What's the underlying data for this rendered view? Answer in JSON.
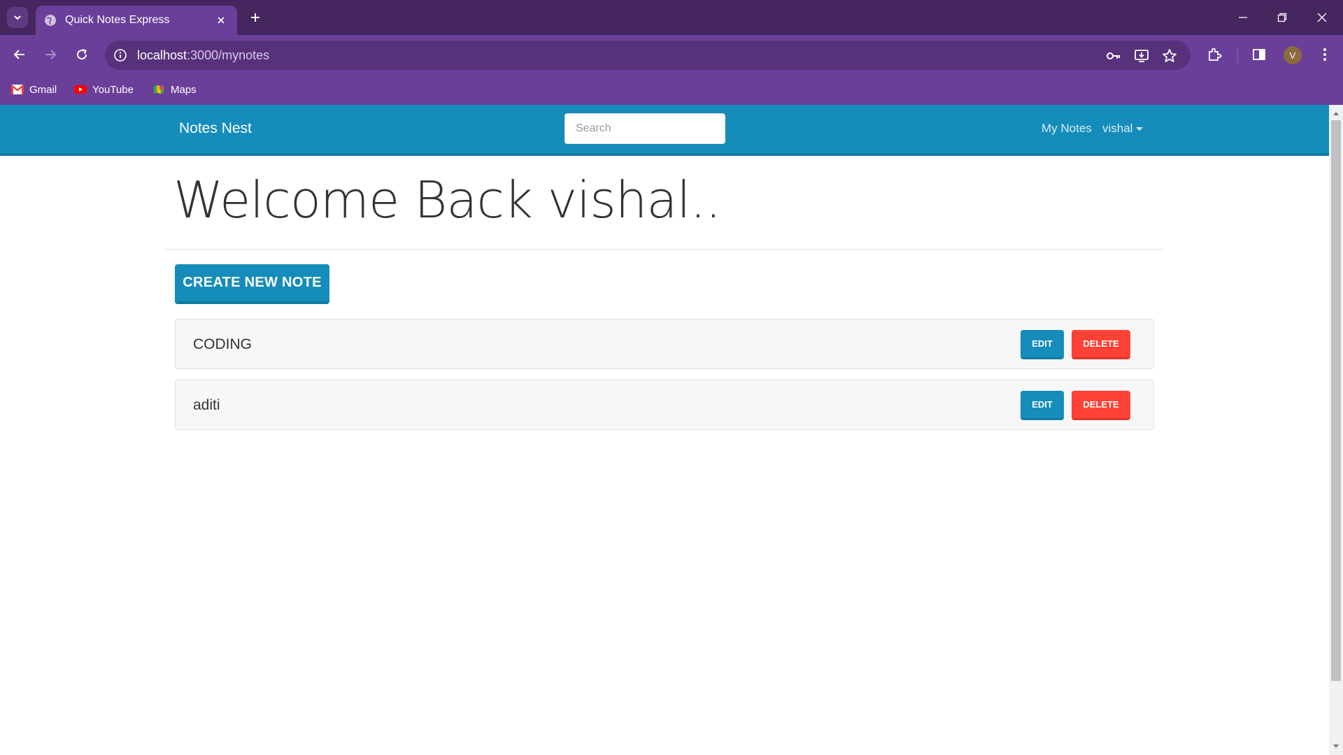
{
  "browser": {
    "tab_title": "Quick Notes Express",
    "url_host": "localhost",
    "url_path": ":3000/mynotes",
    "profile_initial": "V",
    "bookmarks": [
      {
        "label": "Gmail"
      },
      {
        "label": "YouTube"
      },
      {
        "label": "Maps"
      }
    ]
  },
  "nav": {
    "brand": "Notes Nest",
    "search_placeholder": "Search",
    "my_notes": "My Notes",
    "user": "vishal"
  },
  "main": {
    "welcome": "Welcome Back vishal..",
    "create_label": "CREATE NEW NOTE",
    "notes": [
      {
        "title": "CODING",
        "edit_label": "EDIT",
        "delete_label": "DELETE"
      },
      {
        "title": "aditi",
        "edit_label": "EDIT",
        "delete_label": "DELETE"
      }
    ]
  },
  "colors": {
    "chrome_dark": "#45265f",
    "chrome": "#6a3f99",
    "primary": "#158cba",
    "danger": "#ff4136"
  }
}
